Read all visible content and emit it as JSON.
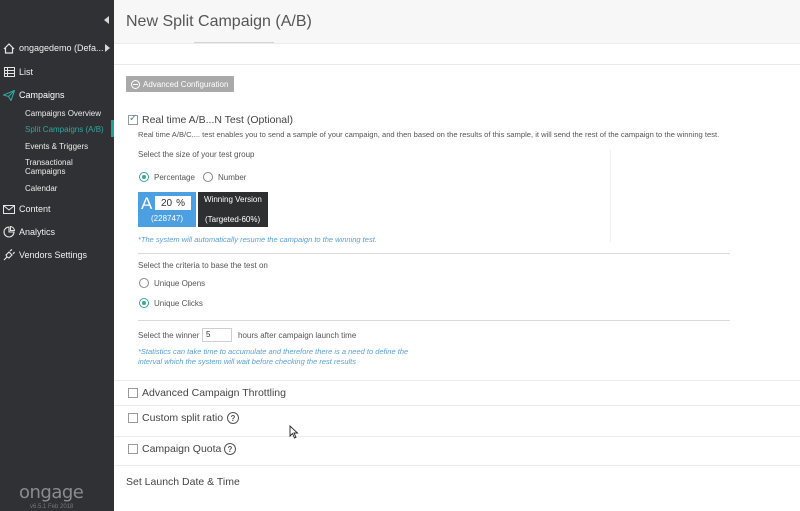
{
  "sidebar": {
    "account": "ongagedemo (Defa...",
    "nav": [
      {
        "label": "List",
        "icon": "list-icon"
      },
      {
        "label": "Campaigns",
        "icon": "paper-plane-icon"
      },
      {
        "label": "Content",
        "icon": "envelope-icon"
      },
      {
        "label": "Analytics",
        "icon": "analytics-icon"
      },
      {
        "label": "Vendors Settings",
        "icon": "plug-icon"
      }
    ],
    "campaign_sub": [
      "Campaigns Overview",
      "Split Campaigns (A/B)",
      "Events & Triggers",
      "Transactional Campaigns",
      "Calendar"
    ],
    "brand": "ongage",
    "version": "v6.5.1 Feb 2018"
  },
  "page": {
    "title": "New Split Campaign (A/B)"
  },
  "advanced_config": {
    "label": "Advanced Configuration"
  },
  "ab_test": {
    "title": "Real time A/B...N Test (Optional)",
    "description": "Real time A/B/C.... test enables you to send a sample of your campaign, and then based on the results of this sample, it will send the rest of the campaign to the winning test.",
    "size_label": "Select the size of your test group",
    "size_options": [
      "Percentage",
      "Number"
    ],
    "selected_size": "Percentage",
    "group_a": {
      "letter": "A",
      "percent": "20",
      "percent_sign": "%",
      "count": "(228747)"
    },
    "winning": {
      "line1": "Winning Version",
      "line2": "(Targeted-60%)"
    },
    "resume_note": "*The system will automatically resume the campaign to the winning test.",
    "criteria_label": "Select the criteria to base the test on",
    "criteria_options": [
      "Unique Opens",
      "Unique Clicks"
    ],
    "selected_criteria": "Unique Clicks",
    "winner_prefix": "Select the winner",
    "winner_hours": "5",
    "winner_suffix": "hours after campaign launch time",
    "stats_note_1": "*Statistics can take time to accumulate and therefore there is a need to define the",
    "stats_note_2": "interval which the system will wait before checking the rest results"
  },
  "options": {
    "throttling": "Advanced Campaign Throttling",
    "split_ratio": "Custom split ratio",
    "quota": "Campaign Quota",
    "help_glyph": "?"
  },
  "launch": {
    "title": "Set Launch Date & Time"
  },
  "colors": {
    "sidebar_bg": "#2f3134",
    "accent_teal": "#21a09a",
    "group_a_blue": "#4c9fe0",
    "note_blue": "#5aa0d6"
  }
}
